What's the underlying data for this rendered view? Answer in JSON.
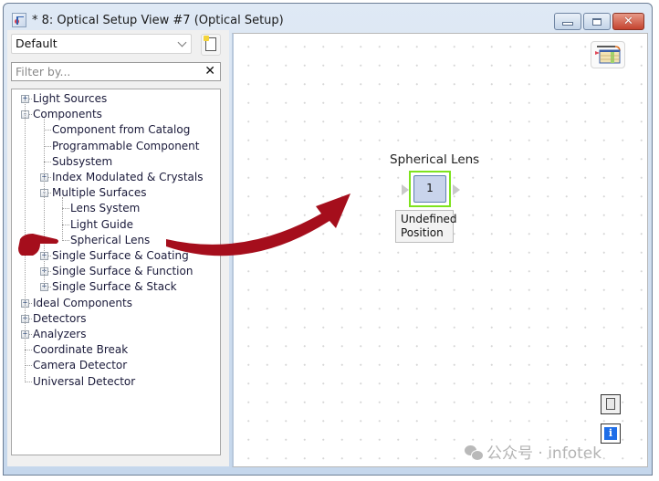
{
  "window": {
    "title": "* 8: Optical Setup View #7 (Optical Setup)",
    "controls": {
      "minimize": "minimize",
      "maximize": "maximize",
      "close": "✕"
    }
  },
  "left_panel": {
    "preset_select": {
      "value": "Default"
    },
    "filter": {
      "placeholder": "Filter by...",
      "value": "",
      "clear_label": "✕"
    },
    "tree": [
      {
        "label": "Light Sources",
        "level": 0,
        "expander": "+"
      },
      {
        "label": "Components",
        "level": 0,
        "expander": "−"
      },
      {
        "label": "Component from Catalog",
        "level": 1,
        "expander": ""
      },
      {
        "label": "Programmable Component",
        "level": 1,
        "expander": ""
      },
      {
        "label": "Subsystem",
        "level": 1,
        "expander": ""
      },
      {
        "label": "Index Modulated & Crystals",
        "level": 1,
        "expander": "+"
      },
      {
        "label": "Multiple Surfaces",
        "level": 1,
        "expander": "−"
      },
      {
        "label": "Lens System",
        "level": 2,
        "expander": ""
      },
      {
        "label": "Light Guide",
        "level": 2,
        "expander": ""
      },
      {
        "label": "Spherical Lens",
        "level": 2,
        "expander": ""
      },
      {
        "label": "Single Surface & Coating",
        "level": 1,
        "expander": "+"
      },
      {
        "label": "Single Surface & Function",
        "level": 1,
        "expander": "+"
      },
      {
        "label": "Single Surface & Stack",
        "level": 1,
        "expander": "+"
      },
      {
        "label": "Ideal Components",
        "level": 0,
        "expander": "+"
      },
      {
        "label": "Detectors",
        "level": 0,
        "expander": "+"
      },
      {
        "label": "Analyzers",
        "level": 0,
        "expander": "+"
      },
      {
        "label": "Coordinate Break",
        "level": 0,
        "expander": ""
      },
      {
        "label": "Camera Detector",
        "level": 0,
        "expander": ""
      },
      {
        "label": "Universal Detector",
        "level": 0,
        "expander": ""
      }
    ]
  },
  "canvas": {
    "component": {
      "name": "Spherical Lens",
      "index": "1",
      "position_status_line1": "Undefined",
      "position_status_line2": "Position",
      "selection_color": "#7ee31d"
    },
    "buttons": {
      "catalog": "catalog-icon",
      "document": "document-icon",
      "info": "i"
    }
  },
  "annotation": {
    "arrow_color": "#a50e1c",
    "pointer": "hand-pointer"
  },
  "watermark": {
    "text": "公众号 · infotek"
  }
}
